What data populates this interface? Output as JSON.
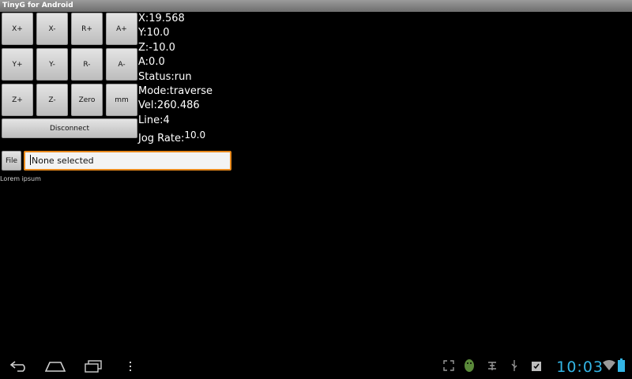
{
  "window": {
    "title": "TinyG for Android"
  },
  "jog_buttons": {
    "x_plus": "X+",
    "x_minus": "X-",
    "r_plus": "R+",
    "a_plus": "A+",
    "y_plus": "Y+",
    "y_minus": "Y-",
    "r_minus": "R-",
    "a_minus": "A-",
    "z_plus": "Z+",
    "z_minus": "Z-",
    "zero": "Zero",
    "units": "mm"
  },
  "disconnect_label": "Disconnect",
  "status": {
    "x": "X:19.568",
    "y": "Y:10.0",
    "z": "Z:-10.0",
    "a": "A:0.0",
    "state": "Status:run",
    "mode": "Mode:traverse",
    "vel": "Vel:260.486",
    "line": "Line:4",
    "jog_rate_label": "Jog Rate:",
    "jog_rate_value": "10.0"
  },
  "file": {
    "button_label": "File",
    "input_value": "None selected"
  },
  "footer_text": "Lorem ipsum",
  "system_bar": {
    "time": "10:03",
    "accent_color": "#33b5e5",
    "icons": [
      "back-icon",
      "home-icon",
      "recent-apps-icon",
      "menu-icon",
      "fullscreen-icon",
      "android-icon",
      "usb-debug-icon",
      "usb-icon",
      "clipboard-check-icon",
      "wifi-icon",
      "battery-icon"
    ]
  }
}
